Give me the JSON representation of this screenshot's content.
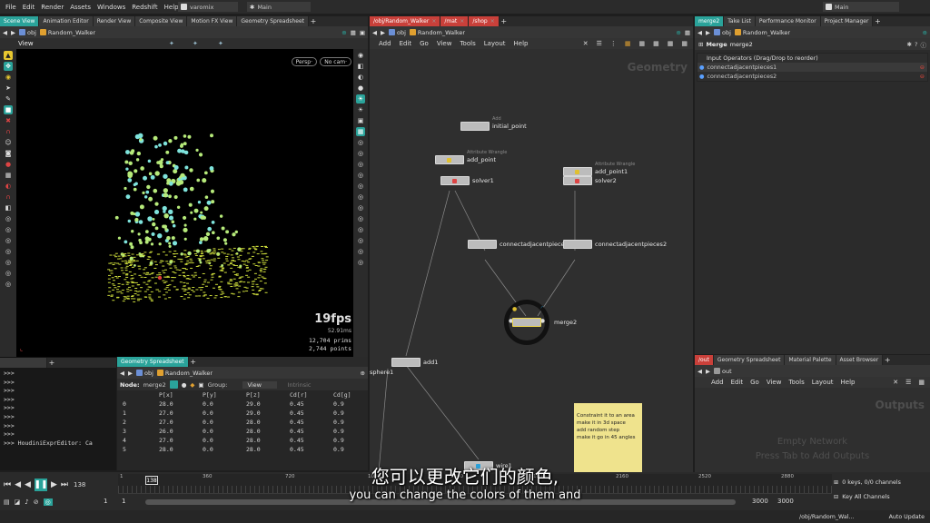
{
  "menu": {
    "items": [
      "File",
      "Edit",
      "Render",
      "Assets",
      "Windows",
      "Redshift",
      "Help"
    ],
    "desktop": "varomix",
    "desktop_left": "Main",
    "desktop_right": "Main"
  },
  "viewer": {
    "tabs": [
      "Scene View",
      "Animation Editor",
      "Render View",
      "Composite View",
      "Motion FX View",
      "Geometry Spreadsheet"
    ],
    "path_obj": "obj",
    "path_node": "Random_Walker",
    "title": "View",
    "persp": "Persp·",
    "cam": "No cam·",
    "fps": "19fps",
    "ms": "52.91ms",
    "prims_val": "12,704",
    "prims_lbl": "prims",
    "points_val": "2,744",
    "points_lbl": "points"
  },
  "network": {
    "tabs": [
      "/obj/Random_Walker",
      "/mat",
      "/shop"
    ],
    "path_obj": "obj",
    "path_node": "Random_Walker",
    "menu": [
      "Add",
      "Edit",
      "Go",
      "View",
      "Tools",
      "Layout",
      "Help"
    ],
    "context_label": "Geometry",
    "nodes": {
      "initial_point": {
        "name": "initial_point",
        "sub": "Add"
      },
      "add_point": {
        "name": "add_point",
        "sub": "Attribute Wrangle"
      },
      "add_point1": {
        "name": "add_point1",
        "sub": "Attribute Wrangle"
      },
      "solver1": {
        "name": "solver1"
      },
      "solver2": {
        "name": "solver2"
      },
      "cap1": {
        "name": "connectadjacentpieces1"
      },
      "cap2": {
        "name": "connectadjacentpieces2"
      },
      "merge2": {
        "name": "merge2"
      },
      "add1": {
        "name": "add1"
      },
      "sphere1": {
        "name": "sphere1"
      },
      "wire1": {
        "name": "wire1"
      }
    },
    "sticky": [
      "Constraint it to an area",
      "make it in 3d space",
      "add random step",
      "make it go in 45 angles"
    ]
  },
  "params": {
    "tabs": [
      "merge2",
      "Take List",
      "Performance Monitor",
      "Project Manager"
    ],
    "node_type": "Merge",
    "node_name": "merge2",
    "header": "Input Operators (Drag/Drop to reorder)",
    "inputs": [
      "connectadjacentpieces1",
      "connectadjacentpieces2"
    ]
  },
  "outputs": {
    "tabs": [
      "/out",
      "Geometry Spreadsheet",
      "Material Palette",
      "Asset Browser"
    ],
    "path": "out",
    "menu": [
      "Add",
      "Edit",
      "Go",
      "View",
      "Tools",
      "Layout",
      "Help"
    ],
    "context_label": "Outputs",
    "empty1": "Empty Network",
    "empty2": "Press Tab to Add Outputs"
  },
  "spreadsheet": {
    "tab": "Geometry Spreadsheet",
    "path_obj": "obj",
    "path_node": "Random_Walker",
    "node_label": "Node:",
    "node_value": "merge2",
    "group_label": "Group:",
    "view_label": "View",
    "intrinsic_label": "Intrinsic",
    "columns": [
      "",
      "P[x]",
      "P[y]",
      "P[z]",
      "Cd[r]",
      "Cd[g]"
    ],
    "rows": [
      [
        "0",
        "28.0",
        "0.0",
        "29.0",
        "0.45",
        "0.9"
      ],
      [
        "1",
        "27.0",
        "0.0",
        "29.0",
        "0.45",
        "0.9"
      ],
      [
        "2",
        "27.0",
        "0.0",
        "28.0",
        "0.45",
        "0.9"
      ],
      [
        "3",
        "26.0",
        "0.0",
        "28.0",
        "0.45",
        "0.9"
      ],
      [
        "4",
        "27.0",
        "0.0",
        "28.0",
        "0.45",
        "0.9"
      ],
      [
        "5",
        "28.0",
        "0.0",
        "28.0",
        "0.45",
        "0.9"
      ]
    ]
  },
  "console": {
    "lines": [
      ">>>",
      ">>>",
      ">>>",
      ">>>",
      ">>>",
      ">>>",
      ">>>",
      ">>>"
    ],
    "last": ">>> HoudiniExprEditor: Ca"
  },
  "timeline": {
    "current_frame": "138",
    "frame_box": "138",
    "ticks": [
      "1",
      "360",
      "720",
      "1080",
      "1440",
      "1800",
      "2160",
      "2520",
      "2880"
    ],
    "start": "1",
    "start2": "1",
    "end": "3000",
    "end2": "3000",
    "keys": "0 keys, 0/0 channels",
    "key_all": "Key All Channels",
    "status_path": "/obj/Random_Wal...",
    "auto_update": "Auto Update"
  },
  "subtitles": {
    "zh": "您可以更改它们的颜色,",
    "en": "you can change the colors of them and"
  },
  "colors": {
    "accent_teal": "#2aa39a",
    "red_tab": "#c9403a",
    "point_cyan": "#7ee3dc",
    "point_green": "#b6ea7a",
    "grid_yellow": "#c9d83a",
    "sticky": "#efe38d"
  }
}
